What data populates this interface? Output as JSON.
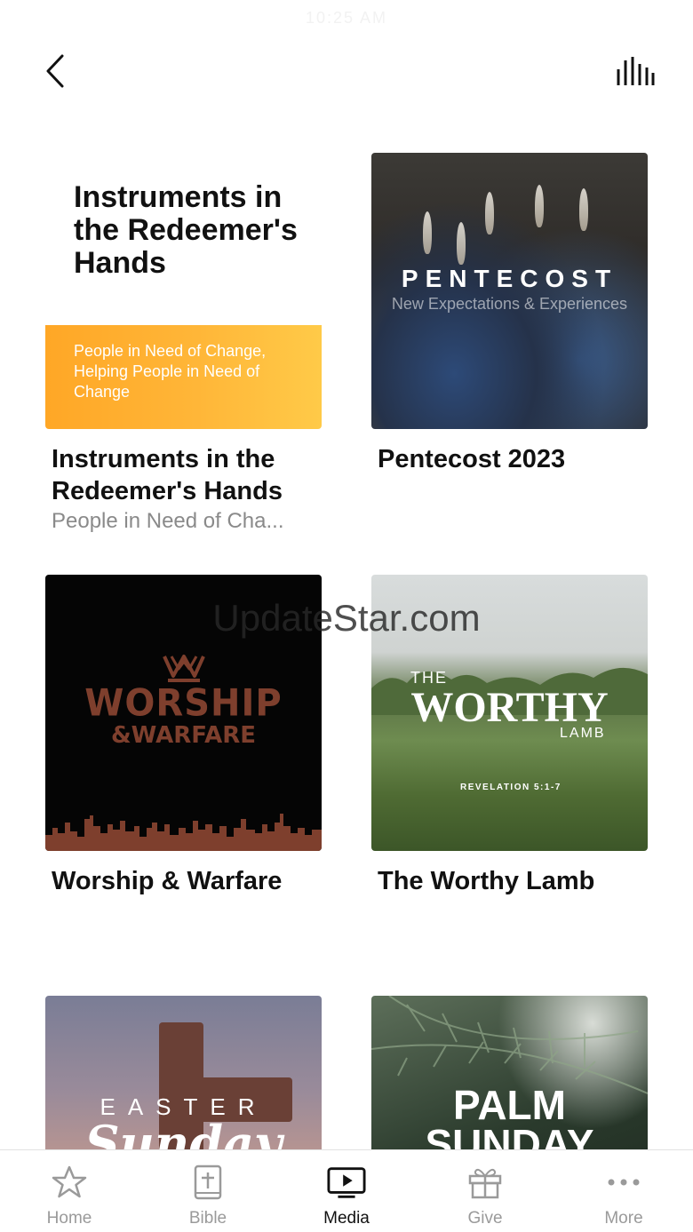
{
  "status": {
    "time": "10:25 AM"
  },
  "header": {
    "back_icon": "chevron-left-icon",
    "audio_icon": "audio-bars-icon"
  },
  "watermark": "UpdateStar.com",
  "series": [
    {
      "title": "Instruments in the Redeemer's Hands",
      "subtitle": "People in Need of Cha...",
      "art": {
        "headline": "Instruments in the Redeemer's Hands",
        "band_text": "People in Need of Change, Helping People in Need of Change",
        "band_color": "#ffb33a"
      }
    },
    {
      "title": "Pentecost 2023",
      "art": {
        "word": "PENTECOST",
        "subword": "New Expectations & Experiences"
      }
    },
    {
      "title": "Worship & Warfare",
      "art": {
        "line1": "WORSHIP",
        "line2": "&WARFARE",
        "color": "#7e3f2d"
      }
    },
    {
      "title": "The Worthy Lamb",
      "art": {
        "the": "THE",
        "worthy": "WORTHY",
        "lamb": "LAMB",
        "ref": "REVELATION 5:1-7"
      }
    },
    {
      "art": {
        "easter": "EASTER",
        "sunday": "Sunday"
      }
    },
    {
      "art": {
        "palm": "PALM",
        "sunday": "SUNDAY"
      }
    }
  ],
  "tabs": [
    {
      "label": "Home",
      "icon": "star-icon",
      "active": false
    },
    {
      "label": "Bible",
      "icon": "bible-icon",
      "active": false
    },
    {
      "label": "Media",
      "icon": "media-tv-icon",
      "active": true
    },
    {
      "label": "Give",
      "icon": "gift-icon",
      "active": false
    },
    {
      "label": "More",
      "icon": "more-dots-icon",
      "active": false
    }
  ]
}
